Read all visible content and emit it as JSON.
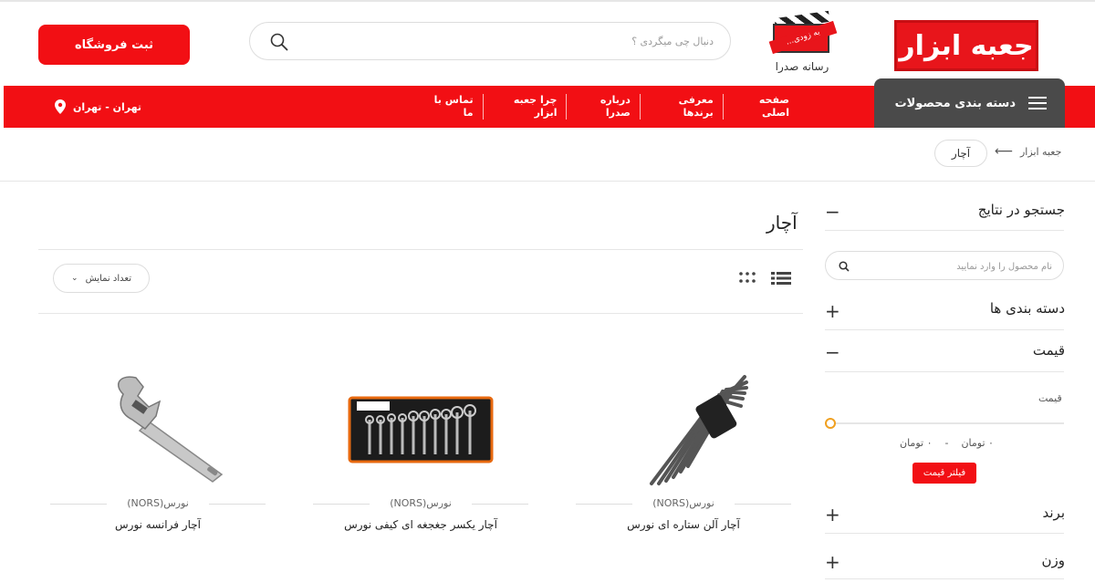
{
  "header": {
    "logo_text": "جعبه ابزار",
    "media_ribbon": "به زودی...",
    "media_caption": "رسانه صدرا",
    "search_placeholder": "دنبال چی میگردی ؟",
    "register_button": "ثبت فروشگاه"
  },
  "nav": {
    "category_button": "دسته بندی محصولات",
    "links": [
      "صفحه اصلی",
      "معرفی برندها",
      "درباره صدرا",
      "چرا جعبه ابزار",
      "تماس با ما"
    ],
    "location": "تهران - تهران"
  },
  "breadcrumb": {
    "home": "جعبه ابزار",
    "current": "آچار"
  },
  "sidebar": {
    "search_title": "جستجو در نتایج",
    "search_placeholder": "نام محصول را وارد نمایید",
    "categories_title": "دسته بندی ها",
    "price_title": "قیمت",
    "price_label": "قیمت",
    "price_min": "۰ تومان",
    "price_max": "۰ تومان",
    "price_separator": "-",
    "filter_button": "فیلتر قیمت",
    "brand_title": "برند",
    "weight_title": "وزن"
  },
  "main": {
    "title": "آچار",
    "count_select": "تعداد نمایش"
  },
  "products": [
    {
      "brand": "نورس(NORS)",
      "name": "آچار آلن ستاره ای نورس"
    },
    {
      "brand": "نورس(NORS)",
      "name": "آچار یکسر جغجغه ای کیفی نورس"
    },
    {
      "brand": "نورس(NORS)",
      "name": "آچار فرانسه نورس"
    }
  ],
  "colors": {
    "accent": "#f20f14",
    "category_bg": "#4a4a4a",
    "slider_handle": "#f0a020"
  }
}
